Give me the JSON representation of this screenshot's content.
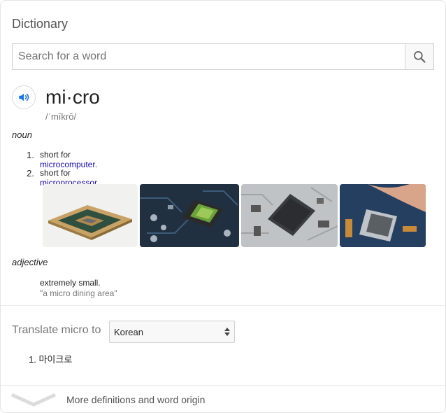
{
  "header": {
    "title": "Dictionary"
  },
  "search": {
    "placeholder": "Search for a word"
  },
  "entry": {
    "word": "mi·cro",
    "phonetic": "/ˈmīkrō/",
    "noun": {
      "label": "noun",
      "definitions": [
        {
          "number": "1.",
          "prefix": "short for ",
          "link": "microcomputer",
          "suffix": "."
        },
        {
          "number": "2.",
          "prefix": "short for ",
          "link": "microprocessor",
          "suffix": "."
        }
      ]
    },
    "images": [
      "cpu-chip-photo",
      "circuit-board-chip-photo",
      "microprocessor-board-photo",
      "cpu-socket-hand-photo"
    ],
    "adjective": {
      "label": "adjective",
      "definition": "extremely small.",
      "example": "\"a micro dining area\""
    }
  },
  "translate": {
    "label": "Translate micro to",
    "language": "Korean",
    "results": [
      {
        "number": "1.",
        "text": "마이크로"
      }
    ]
  },
  "footer": {
    "more_label": "More definitions and word origin"
  },
  "colors": {
    "link": "#1a0dab",
    "speaker": "#1a73e8"
  }
}
